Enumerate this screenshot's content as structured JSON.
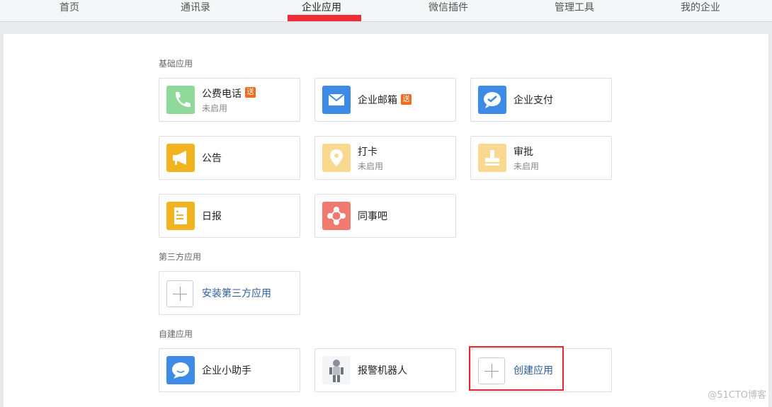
{
  "nav": {
    "items": [
      {
        "label": "首页"
      },
      {
        "label": "通讯录"
      },
      {
        "label": "企业应用"
      },
      {
        "label": "微信插件"
      },
      {
        "label": "管理工具"
      },
      {
        "label": "我的企业"
      }
    ],
    "active_index": 2
  },
  "sections": {
    "basic": {
      "title": "基础应用",
      "apps": [
        {
          "name": "公费电话",
          "status": "未启用",
          "badge": "送",
          "icon": "phone-icon"
        },
        {
          "name": "企业邮箱",
          "badge": "送",
          "icon": "mail-icon"
        },
        {
          "name": "企业支付",
          "icon": "payment-icon"
        },
        {
          "name": "公告",
          "icon": "megaphone-icon"
        },
        {
          "name": "打卡",
          "status": "未启用",
          "icon": "location-pin-icon"
        },
        {
          "name": "审批",
          "status": "未启用",
          "icon": "stamp-icon"
        },
        {
          "name": "日报",
          "icon": "report-icon"
        },
        {
          "name": "同事吧",
          "icon": "network-icon"
        }
      ]
    },
    "third_party": {
      "title": "第三方应用",
      "install_label": "安装第三方应用"
    },
    "custom": {
      "title": "自建应用",
      "apps": [
        {
          "name": "企业小助手",
          "icon": "chat-bubble-icon"
        },
        {
          "name": "报警机器人",
          "icon": "robot-icon"
        }
      ],
      "create_label": "创建应用"
    }
  },
  "watermark": "@51CTO博客",
  "colors": {
    "accent_red": "#f02d36",
    "badge_orange": "#f06a1f",
    "link_blue": "#2b5ea0",
    "phone_green": "#8fd99a",
    "mail_blue": "#3d8be6",
    "megaphone_yellow": "#f2b320",
    "pale_yellow": "#f8d98f",
    "network_red": "#f07a6f"
  }
}
